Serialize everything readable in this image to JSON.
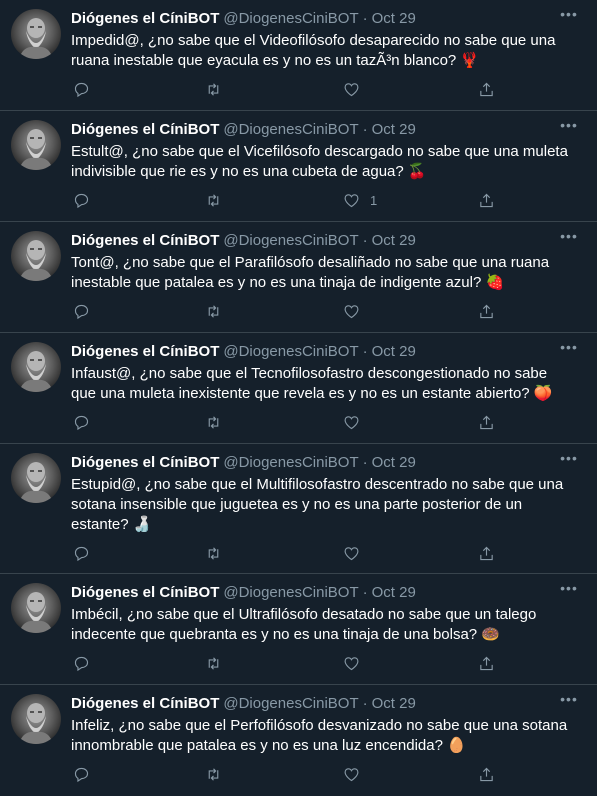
{
  "tweets": [
    {
      "name": "Diógenes el CíniBOT",
      "handle": "@DiogenesCiniBOT",
      "separator": "·",
      "date": "Oct 29",
      "text": "Impedid@, ¿no sabe que el Videofilósofo desaparecido no sabe que una ruana inestable que eyacula es y no es un tazÃ³n blanco? 🦞",
      "like_count": ""
    },
    {
      "name": "Diógenes el CíniBOT",
      "handle": "@DiogenesCiniBOT",
      "separator": "·",
      "date": "Oct 29",
      "text": "Estult@, ¿no sabe que el Vicefilósofo descargado no sabe que una muleta indivisible que rie es y no es una cubeta de agua? 🍒",
      "like_count": "1"
    },
    {
      "name": "Diógenes el CíniBOT",
      "handle": "@DiogenesCiniBOT",
      "separator": "·",
      "date": "Oct 29",
      "text": "Tont@, ¿no sabe que el Parafilósofo desaliñado no sabe que una ruana inestable que patalea es y no es una tinaja de indigente azul? 🍓",
      "like_count": ""
    },
    {
      "name": "Diógenes el CíniBOT",
      "handle": "@DiogenesCiniBOT",
      "separator": "·",
      "date": "Oct 29",
      "text": "Infaust@, ¿no sabe que el Tecnofilosofastro descongestionado no sabe que una muleta inexistente que revela es y no es un estante abierto? 🍑",
      "like_count": ""
    },
    {
      "name": "Diógenes el CíniBOT",
      "handle": "@DiogenesCiniBOT",
      "separator": "·",
      "date": "Oct 29",
      "text": "Estupid@, ¿no sabe que el Multifilosofastro descentrado no sabe que una sotana insensible que juguetea es y no es una parte posterior de un estante? 🍶",
      "like_count": ""
    },
    {
      "name": "Diógenes el CíniBOT",
      "handle": "@DiogenesCiniBOT",
      "separator": "·",
      "date": "Oct 29",
      "text": "Imbécil, ¿no sabe que el Ultrafilósofo desatado no sabe que un talego indecente que quebranta es y no es una tinaja de una bolsa? 🍩",
      "like_count": ""
    },
    {
      "name": "Diógenes el CíniBOT",
      "handle": "@DiogenesCiniBOT",
      "separator": "·",
      "date": "Oct 29",
      "text": "Infeliz, ¿no sabe que el Perfofilósofo desvanizado no sabe que una sotana innombrable que patalea es y no es una luz encendida? 🥚",
      "like_count": ""
    }
  ],
  "icons": {
    "more": "more-horizontal-icon",
    "reply": "reply-icon",
    "retweet": "retweet-icon",
    "like": "heart-icon",
    "share": "share-icon"
  },
  "colors": {
    "background": "#15202b",
    "divider": "#38444d",
    "secondary_text": "#8899a6",
    "primary_text": "#ffffff"
  }
}
